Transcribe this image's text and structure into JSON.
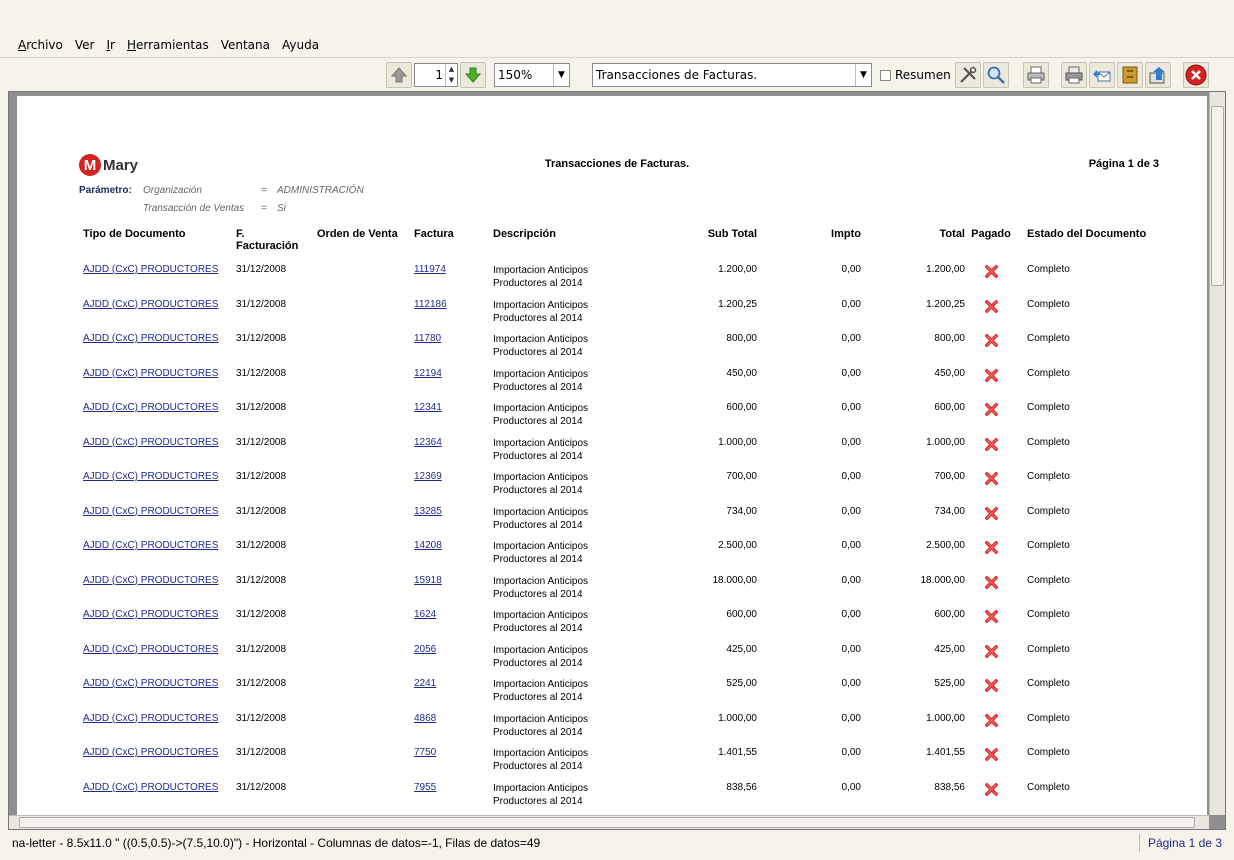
{
  "menu": [
    {
      "label": "Archivo",
      "mnemonic": "A"
    },
    {
      "label": "Ver",
      "mnemonic": ""
    },
    {
      "label": "Ir",
      "mnemonic": "I"
    },
    {
      "label": "Herramientas",
      "mnemonic": "H"
    },
    {
      "label": "Ventana",
      "mnemonic": ""
    },
    {
      "label": "Ayuda",
      "mnemonic": ""
    }
  ],
  "toolbar": {
    "page_value": "1",
    "zoom_value": "150%",
    "report_value": "Transacciones de Facturas.",
    "summary_label": "Resumen"
  },
  "report": {
    "logo_text": "Mary",
    "title": "Transacciones de Facturas.",
    "page_label": "Página 1 de 3",
    "param_label": "Parámetro:",
    "params": [
      {
        "key": "Organización",
        "eq": "=",
        "value": "ADMINISTRACIÓN"
      },
      {
        "key": "Transacción de Ventas",
        "eq": "=",
        "value": "Si"
      }
    ],
    "headers": {
      "tipo": "Tipo de Documento",
      "fecha_1": "F.",
      "fecha_2": "Facturación",
      "orden": "Orden de Venta",
      "factura": "Factura",
      "descripcion": "Descripción",
      "subtotal": "Sub Total",
      "impto": "Impto",
      "total": "Total",
      "pagado": "Pagado",
      "estado": "Estado del Documento"
    },
    "rows": [
      {
        "tipo": "AJDD (CxC) PRODUCTORES",
        "fecha": "31/12/2008",
        "factura": "111974",
        "desc1": "Importacion Anticipos",
        "desc2": "Productores al 2014",
        "subtotal": "1.200,00",
        "impto": "0,00",
        "total": "1.200,00",
        "estado": "Completo"
      },
      {
        "tipo": "AJDD (CxC) PRODUCTORES",
        "fecha": "31/12/2008",
        "factura": "112186",
        "desc1": "Importacion Anticipos",
        "desc2": "Productores al 2014",
        "subtotal": "1.200,25",
        "impto": "0,00",
        "total": "1.200,25",
        "estado": "Completo"
      },
      {
        "tipo": "AJDD (CxC) PRODUCTORES",
        "fecha": "31/12/2008",
        "factura": "11780",
        "desc1": "Importacion Anticipos",
        "desc2": "Productores al 2014",
        "subtotal": "800,00",
        "impto": "0,00",
        "total": "800,00",
        "estado": "Completo"
      },
      {
        "tipo": "AJDD (CxC) PRODUCTORES",
        "fecha": "31/12/2008",
        "factura": "12194",
        "desc1": "Importacion Anticipos",
        "desc2": "Productores al 2014",
        "subtotal": "450,00",
        "impto": "0,00",
        "total": "450,00",
        "estado": "Completo"
      },
      {
        "tipo": "AJDD (CxC) PRODUCTORES",
        "fecha": "31/12/2008",
        "factura": "12341",
        "desc1": "Importacion Anticipos",
        "desc2": "Productores al 2014",
        "subtotal": "600,00",
        "impto": "0,00",
        "total": "600,00",
        "estado": "Completo"
      },
      {
        "tipo": "AJDD (CxC) PRODUCTORES",
        "fecha": "31/12/2008",
        "factura": "12364",
        "desc1": "Importacion Anticipos",
        "desc2": "Productores al 2014",
        "subtotal": "1.000,00",
        "impto": "0,00",
        "total": "1.000,00",
        "estado": "Completo"
      },
      {
        "tipo": "AJDD (CxC) PRODUCTORES",
        "fecha": "31/12/2008",
        "factura": "12369",
        "desc1": "Importacion Anticipos",
        "desc2": "Productores al 2014",
        "subtotal": "700,00",
        "impto": "0,00",
        "total": "700,00",
        "estado": "Completo"
      },
      {
        "tipo": "AJDD (CxC) PRODUCTORES",
        "fecha": "31/12/2008",
        "factura": "13285",
        "desc1": "Importacion Anticipos",
        "desc2": "Productores al 2014",
        "subtotal": "734,00",
        "impto": "0,00",
        "total": "734,00",
        "estado": "Completo"
      },
      {
        "tipo": "AJDD (CxC) PRODUCTORES",
        "fecha": "31/12/2008",
        "factura": "14208",
        "desc1": "Importacion Anticipos",
        "desc2": "Productores al 2014",
        "subtotal": "2.500,00",
        "impto": "0,00",
        "total": "2.500,00",
        "estado": "Completo"
      },
      {
        "tipo": "AJDD (CxC) PRODUCTORES",
        "fecha": "31/12/2008",
        "factura": "15918",
        "desc1": "Importacion Anticipos",
        "desc2": "Productores al 2014",
        "subtotal": "18.000,00",
        "impto": "0,00",
        "total": "18.000,00",
        "estado": "Completo"
      },
      {
        "tipo": "AJDD (CxC) PRODUCTORES",
        "fecha": "31/12/2008",
        "factura": "1624",
        "desc1": "Importacion Anticipos",
        "desc2": "Productores al 2014",
        "subtotal": "600,00",
        "impto": "0,00",
        "total": "600,00",
        "estado": "Completo"
      },
      {
        "tipo": "AJDD (CxC) PRODUCTORES",
        "fecha": "31/12/2008",
        "factura": "2056",
        "desc1": "Importacion Anticipos",
        "desc2": "Productores al 2014",
        "subtotal": "425,00",
        "impto": "0,00",
        "total": "425,00",
        "estado": "Completo"
      },
      {
        "tipo": "AJDD (CxC) PRODUCTORES",
        "fecha": "31/12/2008",
        "factura": "2241",
        "desc1": "Importacion Anticipos",
        "desc2": "Productores al 2014",
        "subtotal": "525,00",
        "impto": "0,00",
        "total": "525,00",
        "estado": "Completo"
      },
      {
        "tipo": "AJDD (CxC) PRODUCTORES",
        "fecha": "31/12/2008",
        "factura": "4868",
        "desc1": "Importacion Anticipos",
        "desc2": "Productores al 2014",
        "subtotal": "1.000,00",
        "impto": "0,00",
        "total": "1.000,00",
        "estado": "Completo"
      },
      {
        "tipo": "AJDD (CxC) PRODUCTORES",
        "fecha": "31/12/2008",
        "factura": "7750",
        "desc1": "Importacion Anticipos",
        "desc2": "Productores al 2014",
        "subtotal": "1.401,55",
        "impto": "0,00",
        "total": "1.401,55",
        "estado": "Completo"
      },
      {
        "tipo": "AJDD (CxC) PRODUCTORES",
        "fecha": "31/12/2008",
        "factura": "7955",
        "desc1": "Importacion Anticipos",
        "desc2": "Productores al 2014",
        "subtotal": "838,56",
        "impto": "0,00",
        "total": "838,56",
        "estado": "Completo"
      }
    ]
  },
  "status": {
    "left": "na-letter - 8.5x11.0 \" ((0.5,0.5)->(7.5,10.0)\") - Horizontal - Columnas de datos=-1, Filas de datos=49",
    "right": "Página 1 de 3"
  },
  "colors": {
    "accent_link": "#1f2a8c",
    "unpaid_mark": "#d42222",
    "viewer_bg": "#8f8f8f"
  }
}
